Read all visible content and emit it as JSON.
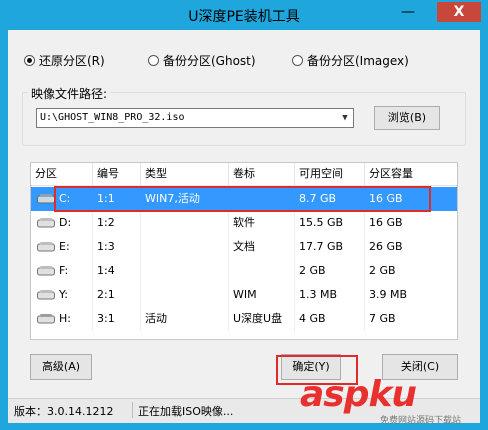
{
  "window": {
    "title": "U深度PE装机工具",
    "minimize_glyph": "—",
    "close_glyph": "X"
  },
  "mode": {
    "options": [
      {
        "label": "还原分区(R)",
        "checked": true
      },
      {
        "label": "备份分区(Ghost)",
        "checked": false
      },
      {
        "label": "备份分区(Imagex)",
        "checked": false
      }
    ]
  },
  "image": {
    "label": "映像文件路径:",
    "path": "U:\\GHOST_WIN8_PRO_32.iso",
    "browse_label": "浏览(B)"
  },
  "table": {
    "columns": [
      "分区",
      "编号",
      "类型",
      "卷标",
      "可用空间",
      "分区容量"
    ],
    "rows": [
      [
        "C:",
        "1:1",
        "WIN7,活动",
        "",
        "8.7 GB",
        "16 GB"
      ],
      [
        "D:",
        "1:2",
        "",
        "软件",
        "15.5 GB",
        "16 GB"
      ],
      [
        "E:",
        "1:3",
        "",
        "文档",
        "17.7 GB",
        "26 GB"
      ],
      [
        "F:",
        "1:4",
        "",
        "",
        "2 GB",
        "2 GB"
      ],
      [
        "Y:",
        "2:1",
        "",
        "WIM",
        "1.3 MB",
        "3.9 MB"
      ],
      [
        "H:",
        "3:1",
        "活动",
        "U深度U盘",
        "4 GB",
        "7 GB"
      ]
    ],
    "selected_row": 0
  },
  "buttons": {
    "advanced": "高级(A)",
    "ok": "确定(Y)",
    "close": "关闭(C)"
  },
  "status": {
    "version": "版本：3.0.14.1212",
    "message": "正在加载ISO映像..."
  },
  "watermark": {
    "main": "aspku",
    "sub": "免费网站源码下载站"
  },
  "colors": {
    "title_bar": "#1fa6dd",
    "selection": "#3399ff",
    "highlight_box": "#e02b2b",
    "close_button": "#c7473a"
  }
}
